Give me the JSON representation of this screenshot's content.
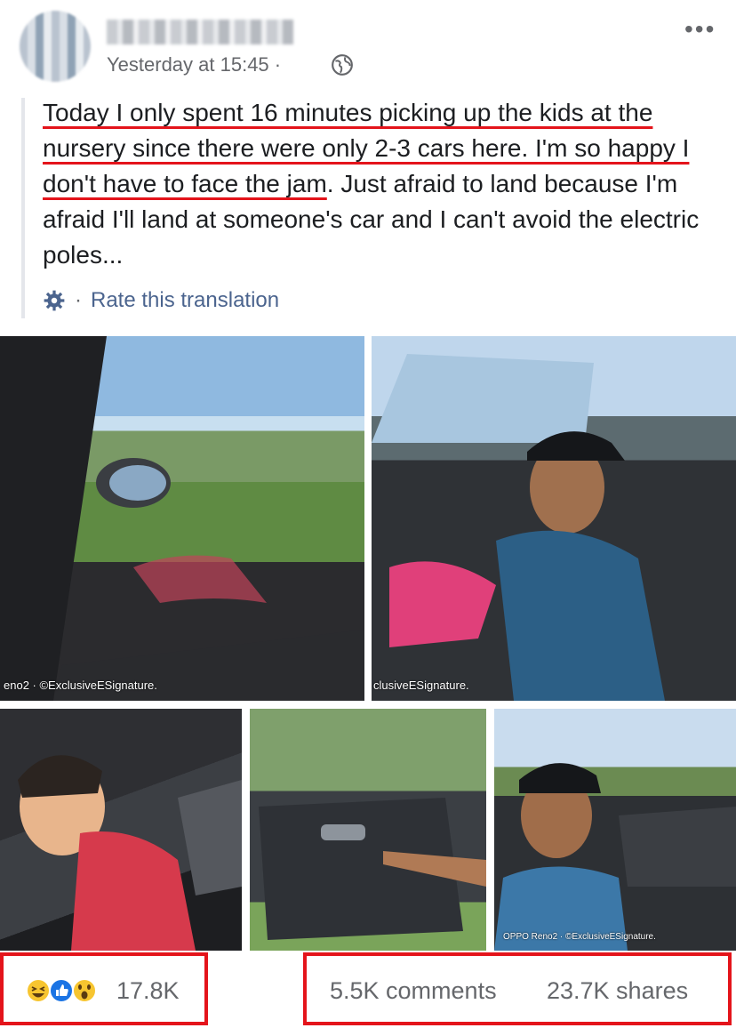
{
  "post": {
    "author_name": "",
    "timestamp": "Yesterday at 15:45 ·",
    "text_highlight": "Today I only spent 16 minutes picking up the kids at the nursery since there were only 2-3 cars here. I'm so happy I don't have to face the jam",
    "text_rest": ". Just afraid to land because I'm afraid I'll land at someone's car and I can't avoid the electric poles...",
    "translation_separator": "·",
    "translation_link": "Rate this translation"
  },
  "photos": {
    "watermark_1": "eno2 · ©ExclusiveESignature.",
    "watermark_2": "clusiveESignature.",
    "watermark_5": "OPPO Reno2 · ©ExclusiveESignature."
  },
  "engagement": {
    "reaction_count": "17.8K",
    "comments": "5.5K comments",
    "shares": "23.7K shares"
  },
  "icons": {
    "globe": "globe-icon",
    "more": "more-icon",
    "gear": "gear-icon",
    "reactions": [
      "haha-icon",
      "like-icon",
      "wow-icon"
    ]
  },
  "colors": {
    "highlight": "#e4141b",
    "link": "#4b648e",
    "secondary_text": "#65676b"
  }
}
